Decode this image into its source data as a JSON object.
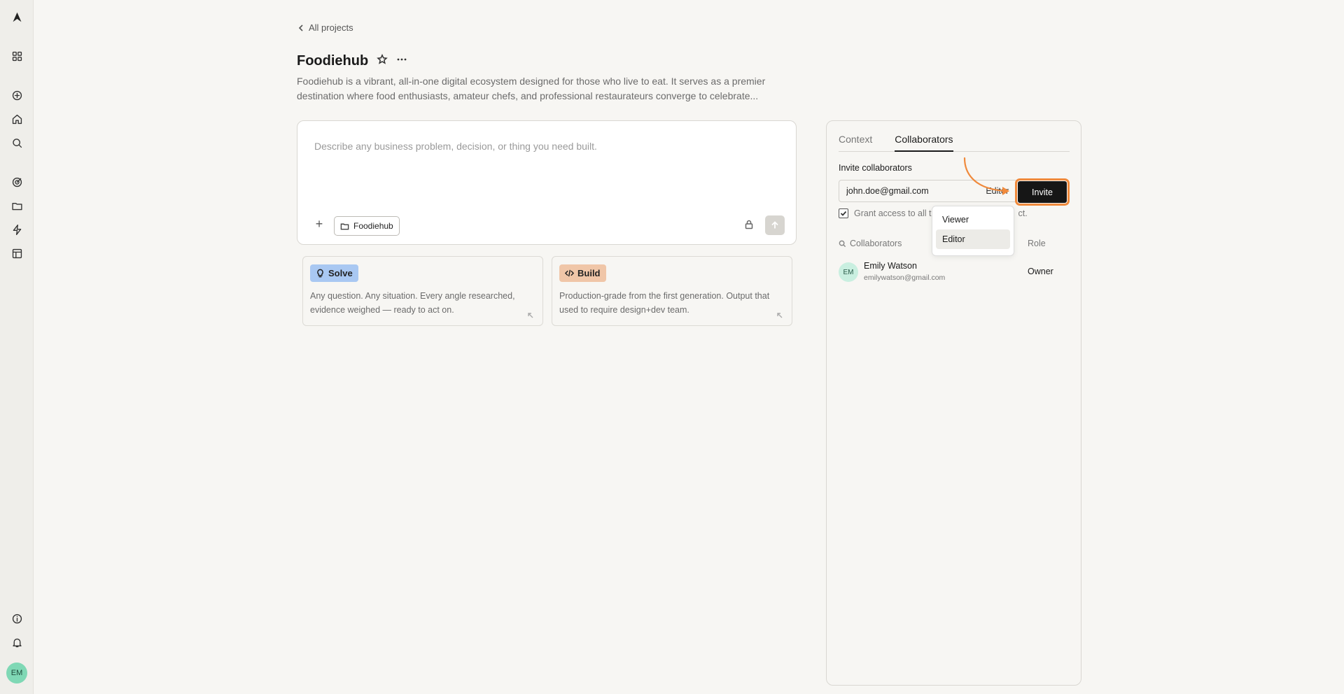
{
  "sidebar": {
    "icons": [
      "logo-icon",
      "grid-icon",
      "add-circle-icon",
      "home-icon",
      "search-icon",
      "target-icon",
      "folder-icon",
      "lightning-icon",
      "layout-icon",
      "info-icon",
      "bell-icon"
    ],
    "user_initials": "EM"
  },
  "header": {
    "back_label": "All projects",
    "title": "Foodiehub",
    "description": "Foodiehub is a vibrant, all-in-one digital ecosystem designed for those who live to eat. It serves as a premier destination where food enthusiasts, amateur chefs, and professional restaurateurs converge to celebrate..."
  },
  "composer": {
    "placeholder": "Describe any business problem, decision, or thing you need built.",
    "plus_label": "+",
    "project_chip": "Foodiehub"
  },
  "modes": [
    {
      "label": "Solve",
      "description": "Any question. Any situation. Every angle researched, evidence weighed — ready to act on."
    },
    {
      "label": "Build",
      "description": "Production-grade from the first generation. Output that used to require design+dev team."
    }
  ],
  "panel": {
    "tabs": [
      {
        "label": "Context"
      },
      {
        "label": "Collaborators"
      }
    ],
    "invite_label": "Invite collaborators",
    "email_value": "john.doe@gmail.com",
    "role_value": "Editor",
    "invite_button": "Invite",
    "grant_text_start": "Grant access to all t",
    "grant_text_end": "ct.",
    "collab_header": "Collaborators",
    "role_header": "Role",
    "collaborators": [
      {
        "initials": "EM",
        "name": "Emily Watson",
        "email": "emilywatson@gmail.com",
        "role": "Owner"
      }
    ]
  },
  "dropdown": {
    "options": [
      "Viewer",
      "Editor"
    ],
    "selected": "Editor"
  },
  "colors": {
    "accent": "#f08a3c",
    "solve_badge": "#a9c8f2",
    "build_badge": "#f0c6a8",
    "primary_button": "#161616"
  }
}
